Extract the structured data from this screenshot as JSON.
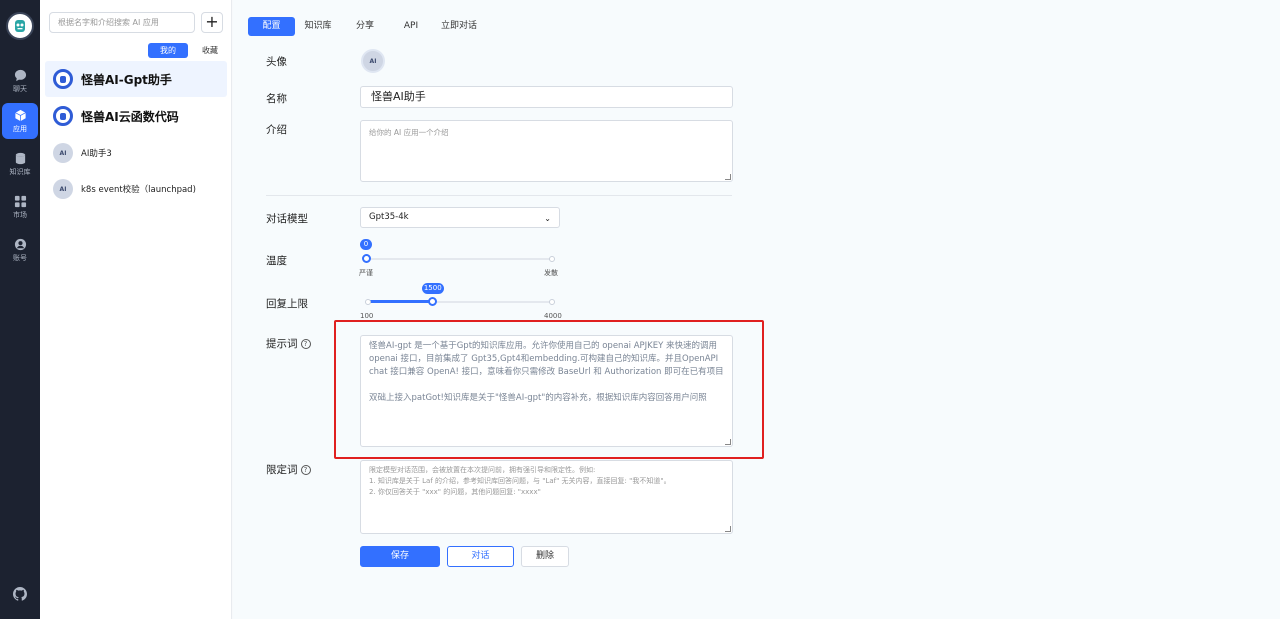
{
  "nav": {
    "items": [
      {
        "label": "聊天",
        "icon": "chat-icon"
      },
      {
        "label": "应用",
        "icon": "cube-icon"
      },
      {
        "label": "知识库",
        "icon": "database-icon"
      },
      {
        "label": "市场",
        "icon": "grid-icon"
      },
      {
        "label": "账号",
        "icon": "user-icon"
      }
    ],
    "active_index": 1,
    "accent_color": "#3370ff"
  },
  "app_list": {
    "search_placeholder": "根据名字和介绍搜索 AI 应用",
    "add_label": "+",
    "tabs": {
      "mine": "我的",
      "favorites": "收藏"
    },
    "apps": [
      {
        "name": "怪兽AI-Gpt助手",
        "avatar_text": "",
        "active": true
      },
      {
        "name": "怪兽AI云函数代码",
        "avatar_text": "",
        "active": false
      },
      {
        "name": "AI助手3",
        "avatar_text": "AI",
        "active": false
      },
      {
        "name": "k8s event校验（launchpad)",
        "avatar_text": "AI",
        "active": false
      }
    ]
  },
  "tabs": [
    "配置",
    "知识库",
    "分享",
    "API",
    "立即对话"
  ],
  "form": {
    "avatar_label": "头像",
    "avatar_text": "AI",
    "name_label": "名称",
    "name_value": "怪兽AI助手",
    "intro_label": "介绍",
    "intro_placeholder": "给你的 AI 应用一个介绍",
    "model_label": "对话模型",
    "model_value": "Gpt35-4k",
    "temperature": {
      "label": "温度",
      "value": "0",
      "min_label": "严谨",
      "max_label": "发散",
      "fraction": 0
    },
    "max_tokens": {
      "label": "回复上限",
      "value": "1500",
      "min": "100",
      "max": "4000",
      "fraction": 0.359
    },
    "prompt_label": "提示词",
    "prompt_lines": [
      "怪兽AI-gpt 是一个基于Gpt的知识库应用。允许你使用自己的 openai APJKEY 来快速的调用",
      "openai 接口，目前集成了 Gpt35,Gpt4和embedding.可构建自己的知识库。并且OpenAPI",
      "chat 接口兼容 OpenA! 接口，意味着你只需修改 BaseUrl 和 Authorization 即可在已有项目",
      "",
      "双础上接入patGot!知识库是关于\"怪兽AI-gpt\"的内容补充，根据知识库内容回答用户问照"
    ],
    "limit_label": "限定词",
    "limit_lines": [
      "限定模型对话范围，会被放置在本次提问前，拥有强引导和限定性。例如:",
      "1. 知识库是关于 Laf 的介绍，参考知识库回答问题，与 \"Laf\" 无关内容，直接回复: \"我不知道\"。",
      "2. 你仅回答关于 \"xxx\" 的问题，其他问题回复: \"xxxx\""
    ]
  },
  "actions": {
    "save": "保存",
    "chat": "对话",
    "delete": "删除"
  },
  "highlight_color": "#e02020"
}
